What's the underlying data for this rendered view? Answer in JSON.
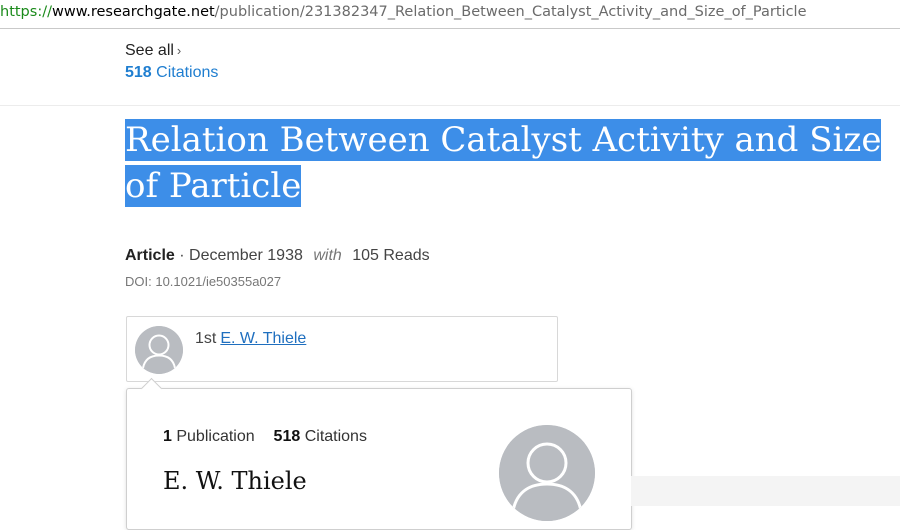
{
  "browser": {
    "url_scheme": "https://",
    "url_host": "www.researchgate.net",
    "url_path": "/publication/231382347_Relation_Between_Catalyst_Activity_and_Size_of_Particle"
  },
  "header": {
    "see_all_label": "See all",
    "see_all_chevron": "›",
    "citations_count": "518",
    "citations_label": "Citations"
  },
  "article": {
    "title": "Relation Between Catalyst Activity and Size of Particle",
    "type": "Article",
    "date": "· December 1938",
    "with_word": "with",
    "reads": "105 Reads",
    "doi": "DOI: 10.1021/ie50355a027"
  },
  "author_card": {
    "ordinal": "1st",
    "author_name": "E. W. Thiele"
  },
  "author_popup": {
    "publications_count": "1",
    "publications_label": "Publication",
    "citations_count": "518",
    "citations_label": "Citations",
    "name": "E. W. Thiele"
  },
  "colors": {
    "link": "#1f7ed0",
    "selection": "#3d8ee8",
    "avatar": "#b9bcc1"
  },
  "icons": {
    "avatar_placeholder": "user-silhouette-icon"
  }
}
